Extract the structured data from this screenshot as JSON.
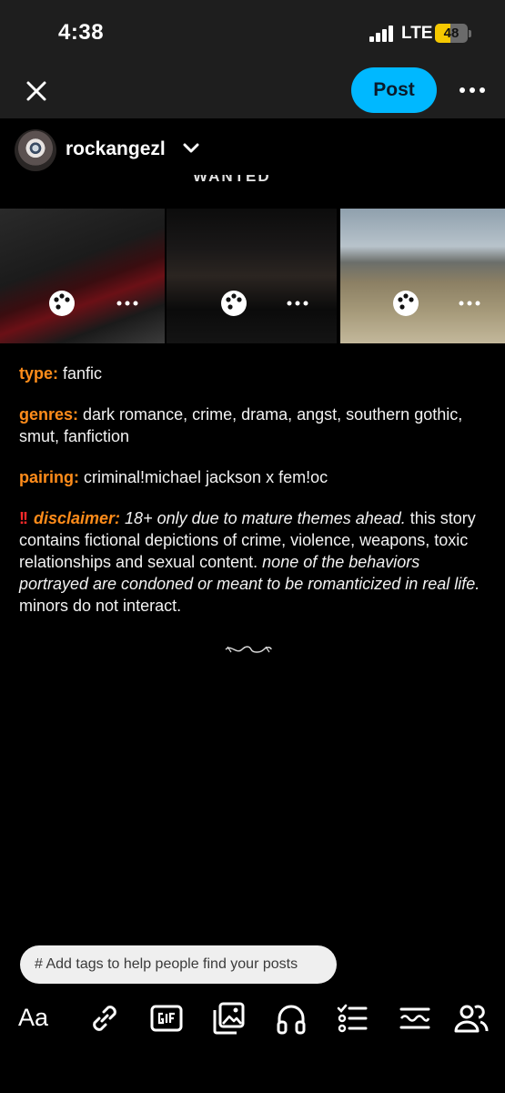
{
  "status_bar": {
    "time": "4:38",
    "network": "LTE",
    "battery": "48",
    "battery_level": 0.48
  },
  "header": {
    "post_button": "Post"
  },
  "blog": {
    "name": "rockangezl"
  },
  "media": {
    "header_fragment": "WANTED"
  },
  "post": {
    "type_label": "type:",
    "type_value": " fanfic",
    "genres_label": "genres:",
    "genres_value": " dark romance, crime, drama, angst, southern gothic, smut, fanfiction",
    "pairing_label": "pairing:",
    "pairing_value": " criminal!michael jackson x fem!oc",
    "disclaimer_marks": "!!",
    "disclaimer_label": "disclaimer:",
    "disclaimer_lead": " 18+ only due to mature themes ahead.",
    "disclaimer_body": " this story contains fictional depictions of crime, violence, weapons, toxic relationships and sexual content. ",
    "disclaimer_italic": "none of the behaviors portrayed are condoned or meant to be romanticized in real life.",
    "disclaimer_tail": " minors do not interact."
  },
  "tags": {
    "placeholder": "# Add tags to help people find your posts"
  },
  "toolbar": {
    "text_tool": "Aa"
  },
  "icons": [
    "close-icon",
    "more-icon",
    "chevron-down-icon",
    "palette-icon",
    "gif-icon",
    "link-icon",
    "image-icon",
    "audio-icon",
    "checklist-icon",
    "divider-icon",
    "people-icon",
    "signal-icon",
    "battery-icon"
  ],
  "colors": {
    "accent": "#00b8ff",
    "label": "#ff8c1a",
    "alert": "#ff2a2a",
    "battery": "#f5c800"
  }
}
